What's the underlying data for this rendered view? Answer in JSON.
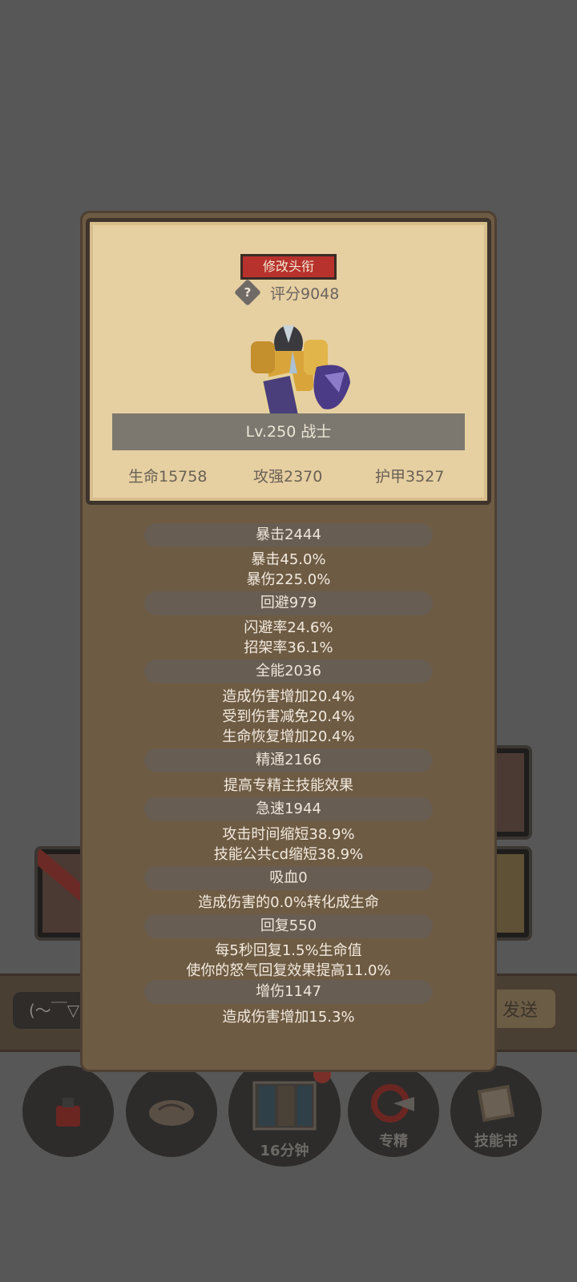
{
  "background": {
    "chat_placeholder": "(～￣▽",
    "send_label": "发送",
    "bottom_buttons": [
      {
        "label": ""
      },
      {
        "label": ""
      },
      {
        "label": "16分钟"
      },
      {
        "label": "专精"
      },
      {
        "label": "技能书"
      }
    ]
  },
  "card": {
    "edit_title_button": "修改头衔",
    "help_icon": "?",
    "score": "评分9048",
    "level_class": "Lv.250 战士",
    "stats": [
      {
        "label": "生命15758"
      },
      {
        "label": "攻强2370"
      },
      {
        "label": "护甲3527"
      }
    ]
  },
  "sections": [
    {
      "title": "暴击2444",
      "lines": [
        "暴击45.0%",
        "暴伤225.0%"
      ]
    },
    {
      "title": "回避979",
      "lines": [
        "闪避率24.6%",
        "招架率36.1%"
      ]
    },
    {
      "title": "全能2036",
      "lines": [
        "造成伤害增加20.4%",
        "受到伤害减免20.4%",
        "生命恢复增加20.4%"
      ]
    },
    {
      "title": "精通2166",
      "lines": [
        "提高专精主技能效果"
      ]
    },
    {
      "title": "急速1944",
      "lines": [
        "攻击时间缩短38.9%",
        "技能公共cd缩短38.9%"
      ]
    },
    {
      "title": "吸血0",
      "lines": [
        "造成伤害的0.0%转化成生命"
      ]
    },
    {
      "title": "回复550",
      "lines": [
        "每5秒回复1.5%生命值",
        "使你的怒气回复效果提高11.0%"
      ]
    },
    {
      "title": "增伤1147",
      "lines": [
        "造成伤害增加15.3%"
      ]
    }
  ],
  "colors": {
    "overlay": "#575757",
    "panel": "#6e5b43",
    "card": "#e6cfa1",
    "title_button": "#b7322d"
  }
}
